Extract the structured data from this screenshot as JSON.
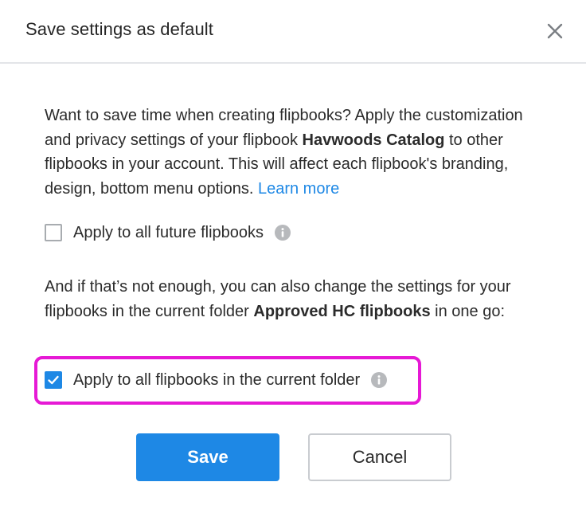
{
  "dialog": {
    "title": "Save settings as default",
    "close_icon": "close-icon"
  },
  "intro": {
    "text_before": "Want to save time when creating flipbooks? Apply the customization and privacy settings of your flipbook ",
    "flipbook_name": "Havwoods Catalog",
    "text_after": " to other flipbooks in your account. This will affect each flipbook's branding, design, bottom menu options. ",
    "learn_more": "Learn more"
  },
  "option_future": {
    "label": "Apply to all future flipbooks",
    "checked": false,
    "info_icon": "info-icon"
  },
  "folder_text": {
    "text_before": "And if that’s not enough, you can also change the settings for your flipbooks in the current folder ",
    "folder_name": "Approved HC flipbooks",
    "text_after": " in one go:"
  },
  "option_folder": {
    "label": "Apply to all flipbooks in the current folder",
    "checked": true,
    "info_icon": "info-icon",
    "highlight_color": "#e619d5"
  },
  "buttons": {
    "save": "Save",
    "cancel": "Cancel"
  },
  "colors": {
    "accent": "#1e88e5",
    "highlight": "#e619d5"
  }
}
